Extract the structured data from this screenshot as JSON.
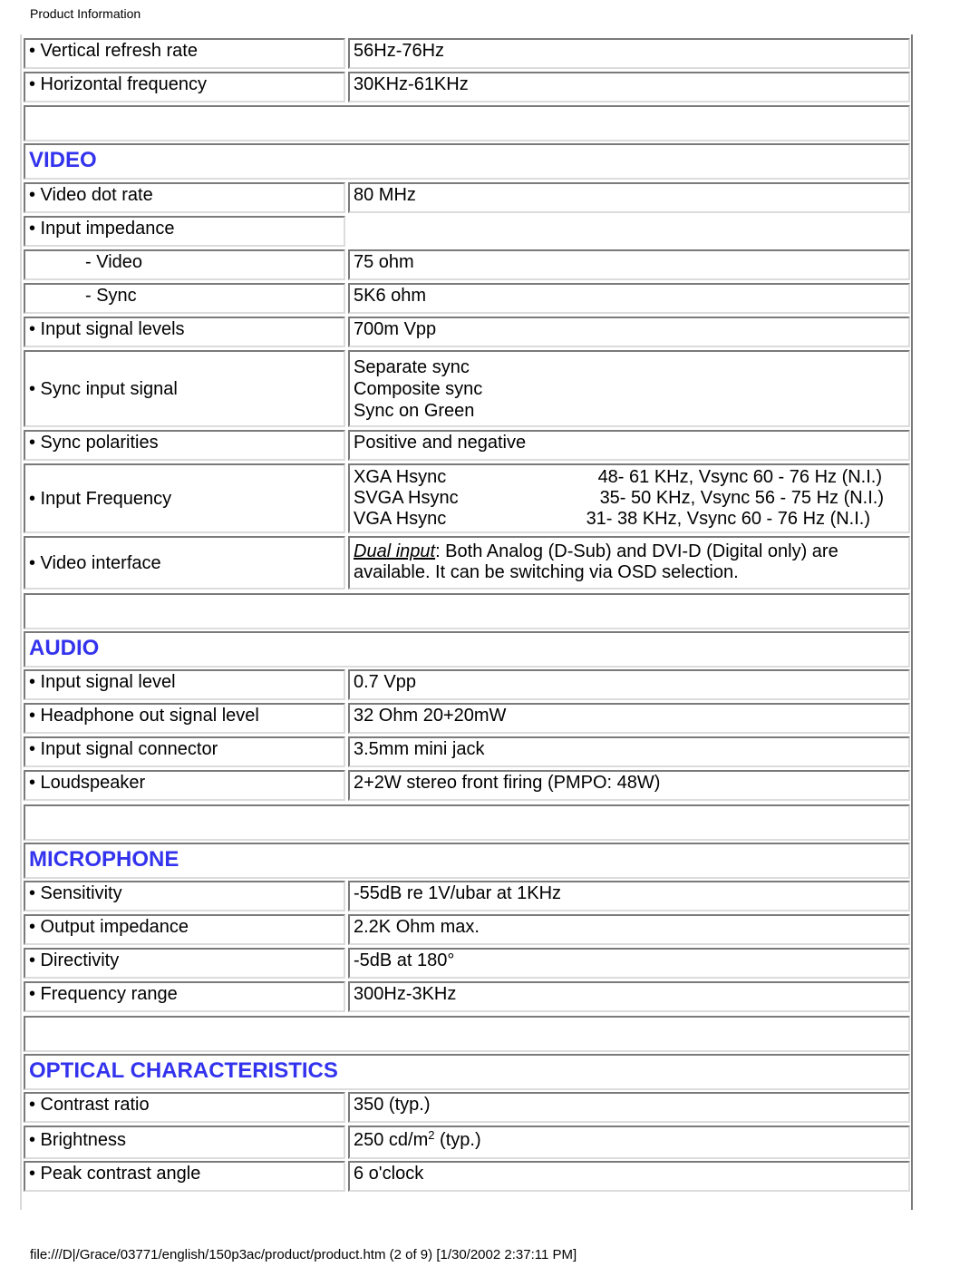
{
  "header": {
    "title": "Product Information"
  },
  "top_rows": [
    {
      "label": "• Vertical refresh rate",
      "value": "56Hz-76Hz"
    },
    {
      "label": "• Horizontal frequency",
      "value": "30KHz-61KHz"
    }
  ],
  "video": {
    "heading": "VIDEO",
    "dot_rate": {
      "label": "• Video dot rate",
      "value": "80 MHz"
    },
    "input_impedance": {
      "label": "• Input impedance"
    },
    "impedance_video": {
      "label": "- Video",
      "value": "75 ohm"
    },
    "impedance_sync": {
      "label": "- Sync",
      "value": "5K6 ohm"
    },
    "input_signal_levels": {
      "label": "• Input signal levels",
      "value": "700m Vpp"
    },
    "sync_input_signal": {
      "label": "• Sync input signal",
      "values": [
        "Separate sync",
        "Composite sync",
        "Sync on Green"
      ]
    },
    "sync_polarities": {
      "label": "• Sync polarities",
      "value": "Positive and negative"
    },
    "input_frequency": {
      "label": "• Input Frequency",
      "rows": [
        {
          "mode": "XGA Hsync",
          "range": "48- 61 KHz, Vsync 60 - 76 Hz (N.I.)"
        },
        {
          "mode": "SVGA Hsync",
          "range": "35- 50 KHz, Vsync 56 - 75 Hz (N.I.)"
        },
        {
          "mode": "VGA Hsync",
          "range": "31- 38 KHz, Vsync 60 - 76 Hz (N.I.)"
        }
      ]
    },
    "video_interface": {
      "label": "• Video interface",
      "link": "Dual input",
      "text": ": Both Analog (D-Sub) and DVI-D (Digital only) are available. It can be switching via OSD selection."
    }
  },
  "audio": {
    "heading": "AUDIO",
    "rows": [
      {
        "label": "• Input signal level",
        "value": "0.7 Vpp"
      },
      {
        "label": "• Headphone out signal level",
        "value": "32 Ohm 20+20mW"
      },
      {
        "label": "• Input signal connector",
        "value": "3.5mm mini jack"
      },
      {
        "label": "• Loudspeaker",
        "value": "2+2W stereo front firing (PMPO: 48W)"
      }
    ]
  },
  "microphone": {
    "heading": "MICROPHONE",
    "rows": [
      {
        "label": "• Sensitivity",
        "value": "-55dB re 1V/ubar at 1KHz"
      },
      {
        "label": "• Output impedance",
        "value": "2.2K Ohm max."
      },
      {
        "label": "• Directivity",
        "value": "-5dB at 180°"
      },
      {
        "label": "• Frequency range",
        "value": "300Hz-3KHz"
      }
    ]
  },
  "optical": {
    "heading": "OPTICAL CHARACTERISTICS",
    "contrast": {
      "label": "• Contrast ratio",
      "value": "350 (typ.)"
    },
    "brightness": {
      "label": "• Brightness",
      "value_pre": "250 cd/m",
      "value_sup": "2",
      "value_post": " (typ.)"
    },
    "peak_angle": {
      "label": "• Peak contrast angle",
      "value": "6 o'clock"
    }
  },
  "footer": {
    "text": "file:///D|/Grace/03771/english/150p3ac/product/product.htm (2 of 9) [1/30/2002 2:37:11 PM]"
  }
}
